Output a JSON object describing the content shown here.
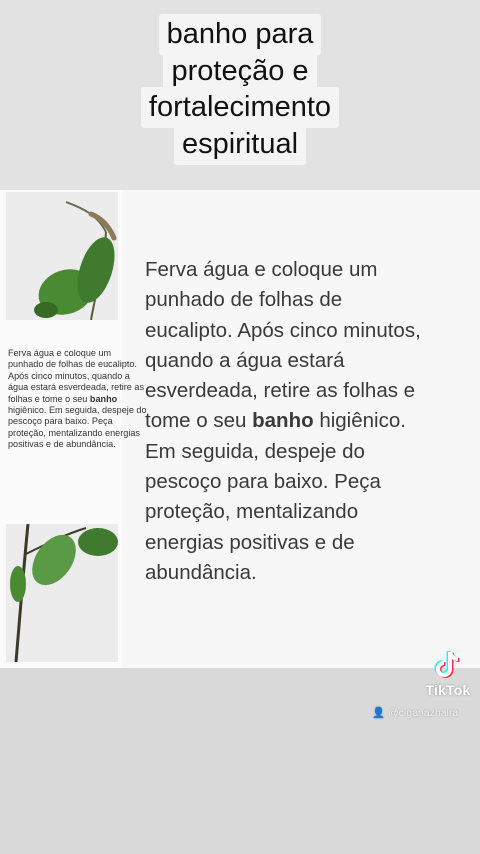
{
  "title": {
    "lines": [
      "banho para",
      "proteção e",
      "fortalecimento",
      "espiritual"
    ]
  },
  "small_text": {
    "before_bold": "Ferva água e coloque um punhado de folhas de eucalipto. Após cinco minutos, quando a água estará esverdeada, retire as folhas e tome o seu ",
    "bold": "banho",
    "after_bold": " higiênico. Em seguida, despeje do pescoço para baixo. Peça proteção, mentalizando energias positivas e de abundância."
  },
  "main_text": {
    "line1": "Ferva água e coloque um",
    "line2": "punhado de folhas de",
    "line3": "eucalipto. Após cinco minutos,",
    "line4": "quando a água estará",
    "line5": "esverdeada, retire as folhas e",
    "line6_before": "tome o seu ",
    "line6_bold": "banho",
    "line6_after": " higiênico.",
    "line7": "Em seguida, despeje do",
    "line8": "pescoço para baixo. Peça",
    "line9": "proteção, mentalizando",
    "line10": "energias positivas e de",
    "line11": "abundância."
  },
  "watermark": {
    "brand": "TikTok",
    "username": "@ciganazhaira",
    "logo_icon": "tiktok-logo-icon",
    "user_icon": "person-icon"
  },
  "colors": {
    "tiktok_cyan": "#25f4ee",
    "tiktok_red": "#fe2c55",
    "leaf_green": "#3f7a2e"
  }
}
